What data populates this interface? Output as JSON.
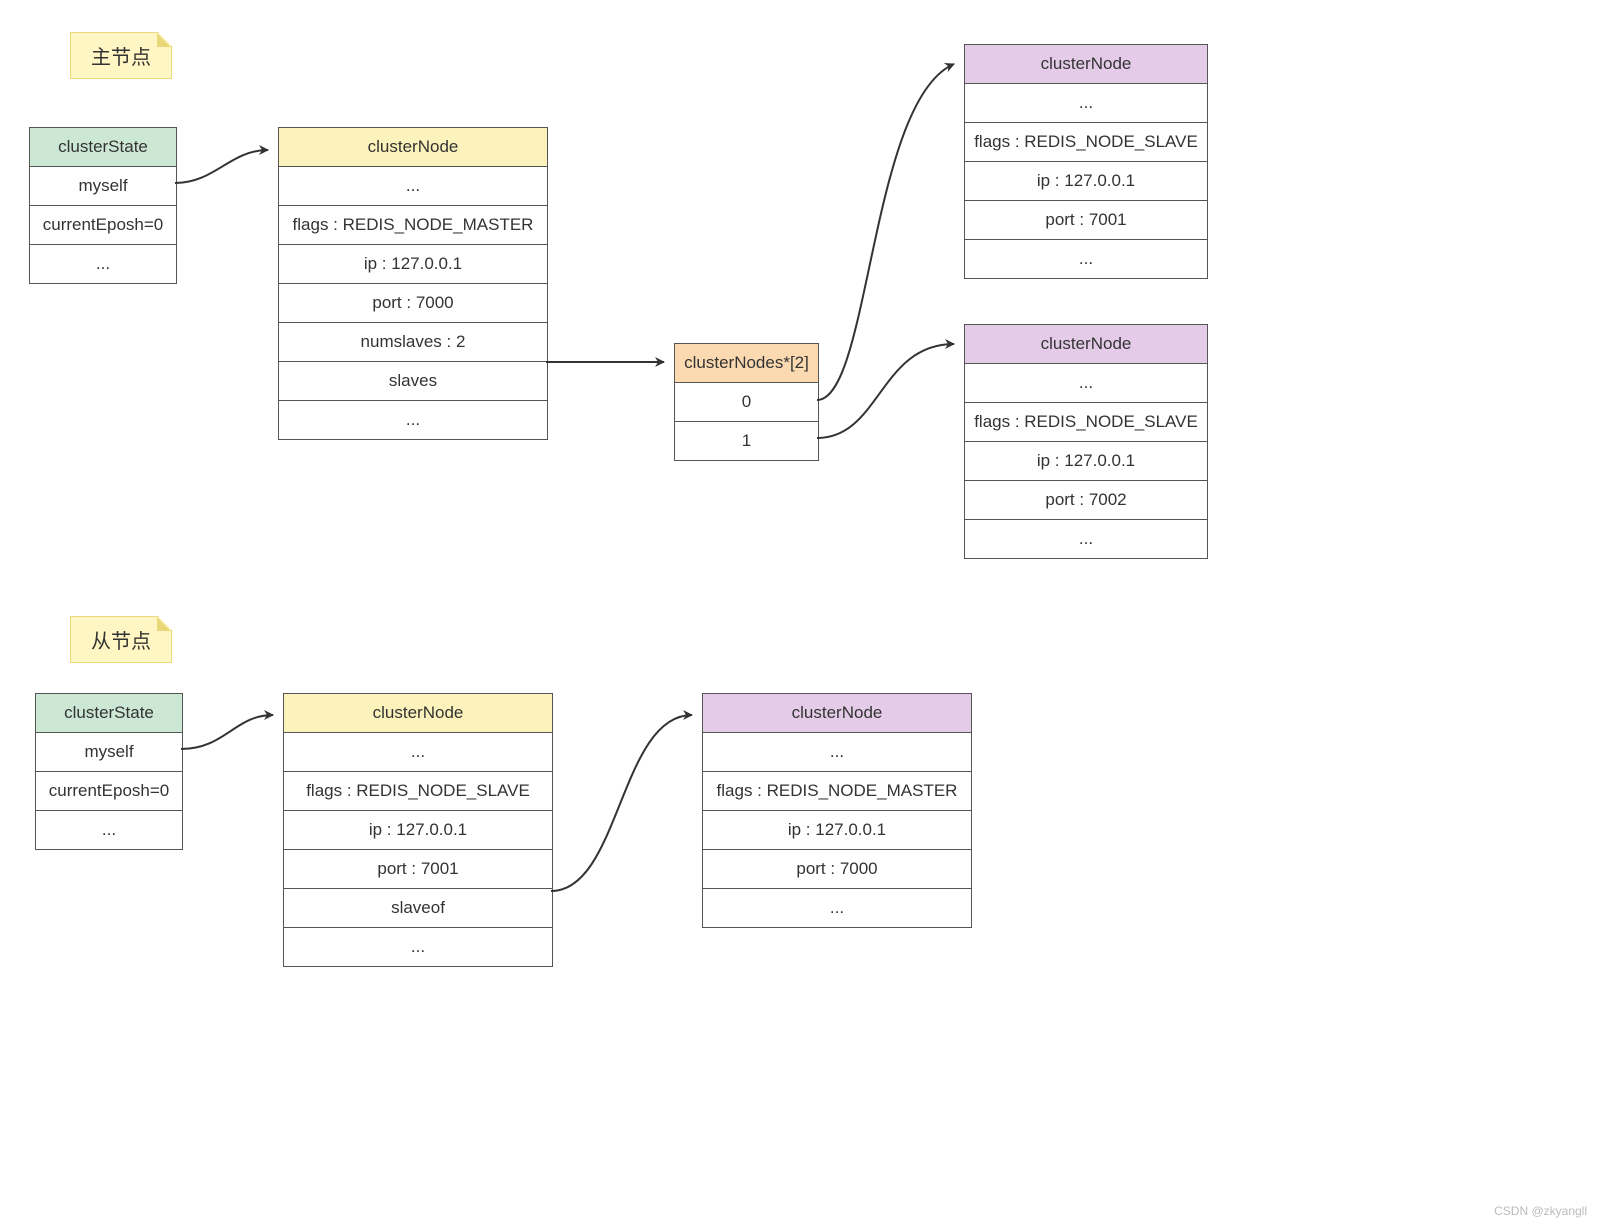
{
  "labels": {
    "master": "主节点",
    "slave": "从节点"
  },
  "master": {
    "state": {
      "header": "clusterState",
      "rows": [
        "myself",
        "currentEposh=0",
        "..."
      ]
    },
    "node": {
      "header": "clusterNode",
      "rows": [
        "...",
        "flags : REDIS_NODE_MASTER",
        "ip : 127.0.0.1",
        "port : 7000",
        "numslaves : 2",
        "slaves",
        "..."
      ]
    },
    "array": {
      "header": "clusterNodes*[2]",
      "rows": [
        "0",
        "1"
      ]
    },
    "slave_a": {
      "header": "clusterNode",
      "rows": [
        "...",
        "flags : REDIS_NODE_SLAVE",
        "ip : 127.0.0.1",
        "port : 7001",
        "..."
      ]
    },
    "slave_b": {
      "header": "clusterNode",
      "rows": [
        "...",
        "flags : REDIS_NODE_SLAVE",
        "ip : 127.0.0.1",
        "port : 7002",
        "..."
      ]
    }
  },
  "slave": {
    "state": {
      "header": "clusterState",
      "rows": [
        "myself",
        "currentEposh=0",
        "..."
      ]
    },
    "node": {
      "header": "clusterNode",
      "rows": [
        "...",
        "flags : REDIS_NODE_SLAVE",
        "ip : 127.0.0.1",
        "port : 7001",
        "slaveof",
        "..."
      ]
    },
    "master_ref": {
      "header": "clusterNode",
      "rows": [
        "...",
        "flags : REDIS_NODE_MASTER",
        "ip : 127.0.0.1",
        "port : 7000",
        "..."
      ]
    }
  },
  "watermark": "CSDN @zkyangll"
}
